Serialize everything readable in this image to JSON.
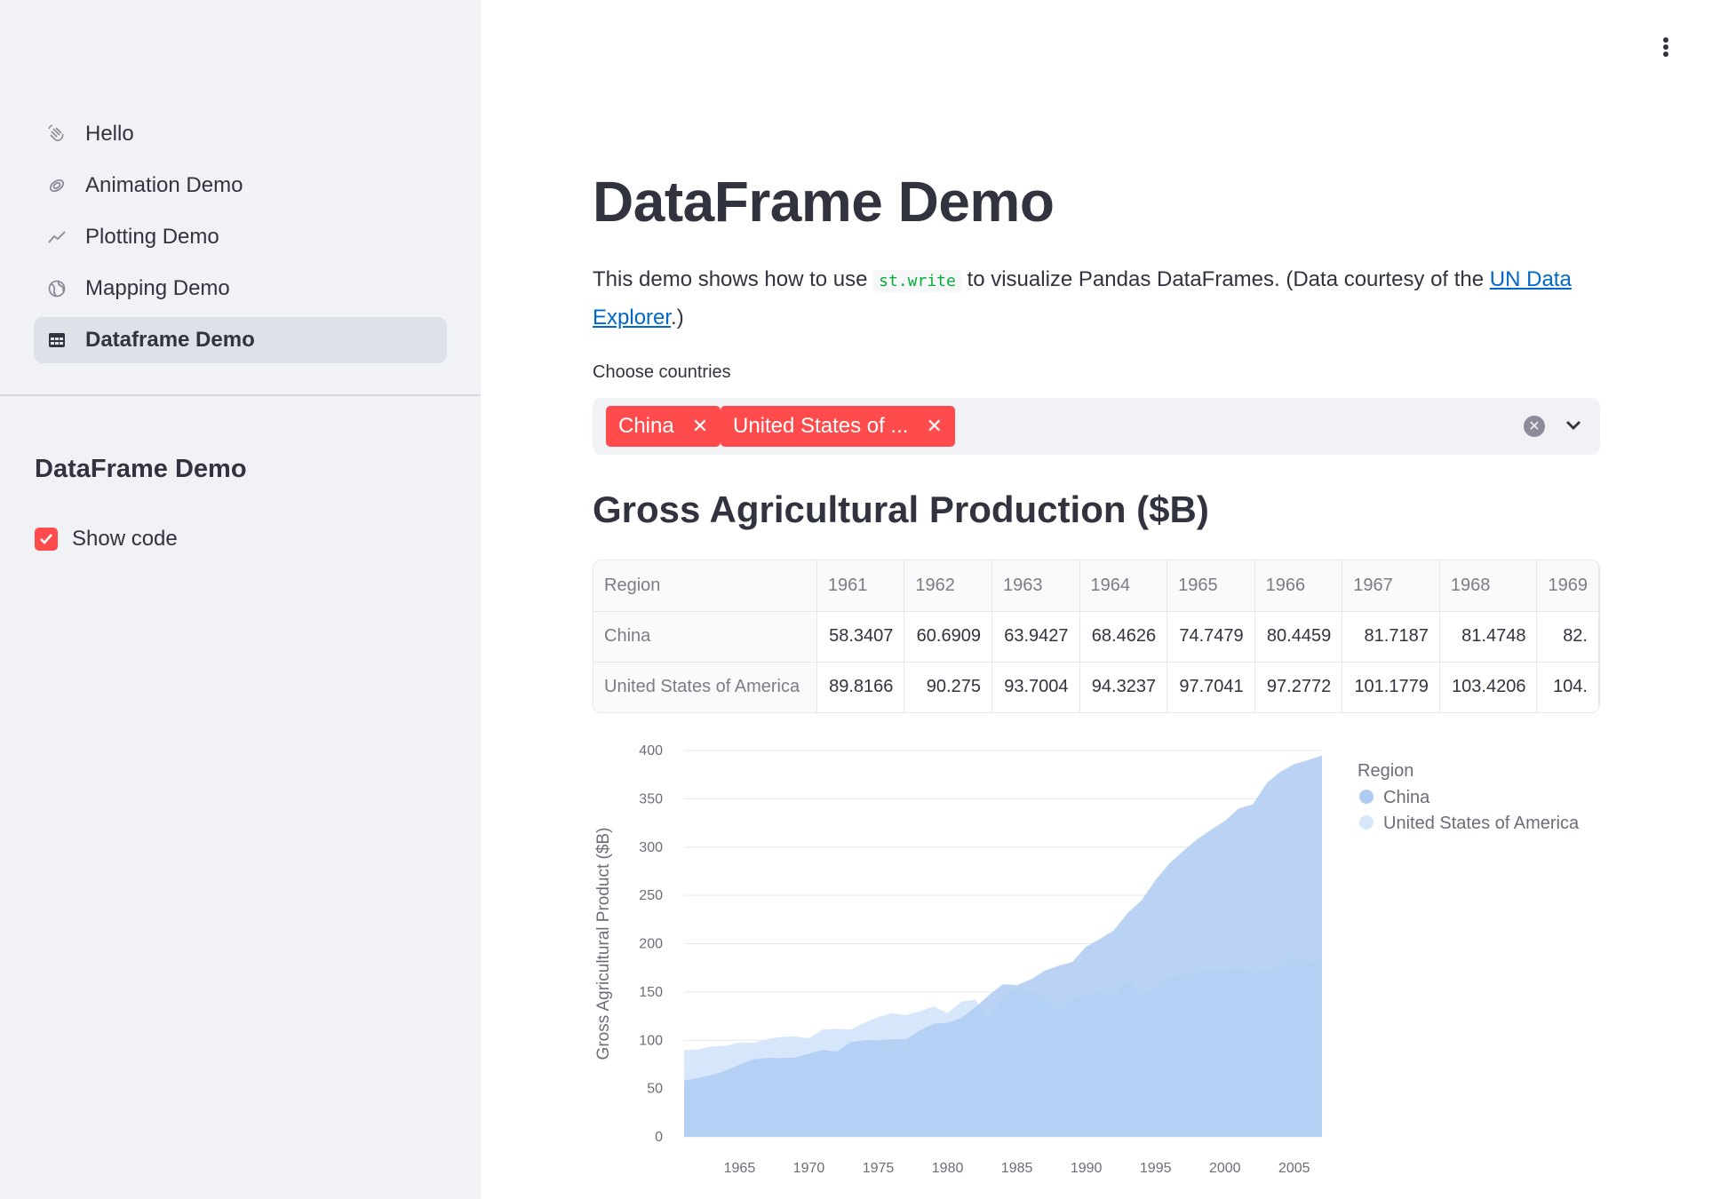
{
  "sidebar": {
    "nav": [
      {
        "label": "Hello",
        "icon": "wave-icon"
      },
      {
        "label": "Animation Demo",
        "icon": "swirl-icon"
      },
      {
        "label": "Plotting Demo",
        "icon": "line-chart-icon"
      },
      {
        "label": "Mapping Demo",
        "icon": "globe-icon"
      },
      {
        "label": "Dataframe Demo",
        "icon": "table-icon",
        "active": true
      }
    ],
    "section_title": "DataFrame Demo",
    "checkbox_label": "Show code",
    "checkbox_checked": true
  },
  "main": {
    "title": "DataFrame Demo",
    "intro_before": "This demo shows how to use ",
    "intro_code": "st.write",
    "intro_middle": " to visualize Pandas DataFrames. (Data courtesy of the ",
    "intro_link": "UN Data Explorer",
    "intro_after": ".)",
    "select_label": "Choose countries",
    "selected_tags": [
      "China",
      "United States of ..."
    ],
    "section_title": "Gross Agricultural Production ($B)"
  },
  "table": {
    "header": [
      "Region",
      "1961",
      "1962",
      "1963",
      "1964",
      "1965",
      "1966",
      "1967",
      "1968",
      "1969"
    ],
    "rows": [
      [
        "China",
        "58.3407",
        "60.6909",
        "63.9427",
        "68.4626",
        "74.7479",
        "80.4459",
        "81.7187",
        "81.4748",
        "82."
      ],
      [
        "United States of America",
        "89.8166",
        "90.275",
        "93.7004",
        "94.3237",
        "97.7041",
        "97.2772",
        "101.1779",
        "103.4206",
        "104."
      ]
    ]
  },
  "colors": {
    "accent": "#ff4b4b",
    "china": "#aecbf2",
    "usa": "#d6e6fb",
    "link": "#0068c9"
  },
  "chart_data": {
    "type": "area",
    "title": "",
    "xlabel": "",
    "ylabel": "Gross Agricultural Product ($B)",
    "ylim": [
      0,
      400
    ],
    "yticks": [
      0,
      50,
      100,
      150,
      200,
      250,
      300,
      350,
      400
    ],
    "xticks": [
      1965,
      1970,
      1975,
      1980,
      1985,
      1990,
      1995,
      2000,
      2005
    ],
    "x": [
      1961,
      1962,
      1963,
      1964,
      1965,
      1966,
      1967,
      1968,
      1969,
      1970,
      1971,
      1972,
      1973,
      1974,
      1975,
      1976,
      1977,
      1978,
      1979,
      1980,
      1981,
      1982,
      1983,
      1984,
      1985,
      1986,
      1987,
      1988,
      1989,
      1990,
      1991,
      1992,
      1993,
      1994,
      1995,
      1996,
      1997,
      1998,
      1999,
      2000,
      2001,
      2002,
      2003,
      2004,
      2005,
      2006,
      2007
    ],
    "legend_title": "Region",
    "legend_position": "right",
    "grid": true,
    "series": [
      {
        "name": "China",
        "values": [
          58.3,
          60.7,
          63.9,
          68.5,
          74.7,
          80.4,
          81.7,
          81.5,
          82,
          86,
          90,
          88,
          98,
          100,
          100,
          101,
          101,
          110,
          117,
          118,
          123,
          134,
          147,
          158,
          157,
          163,
          172,
          177,
          181,
          197,
          205,
          214,
          232,
          245,
          266,
          283,
          296,
          308,
          318,
          327,
          340,
          344,
          366,
          378,
          386,
          390,
          395
        ]
      },
      {
        "name": "United States of America",
        "values": [
          89.8,
          90.3,
          93.7,
          94.3,
          97.7,
          97.3,
          101.2,
          103.4,
          104,
          102,
          111,
          112,
          111,
          118,
          124,
          128,
          126,
          130,
          135,
          128,
          140,
          142,
          122,
          145,
          154,
          150,
          147,
          130,
          145,
          146,
          150,
          146,
          161,
          147,
          155,
          166,
          168,
          170,
          173,
          173,
          175,
          170,
          172,
          177,
          185,
          181,
          184
        ]
      }
    ]
  }
}
